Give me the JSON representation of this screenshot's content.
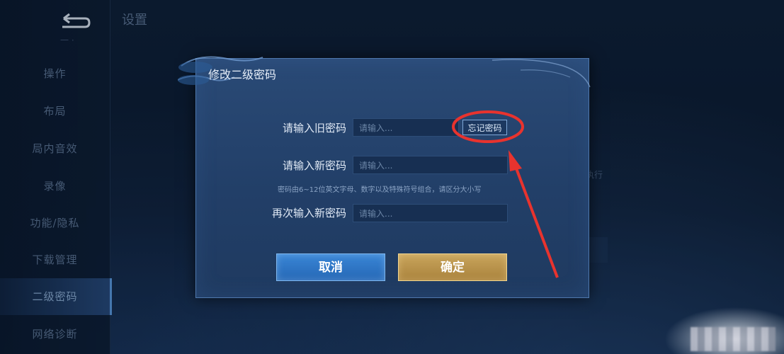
{
  "header": {
    "page_title": "设置"
  },
  "sidebar": {
    "partial_top": "一 ·",
    "items": [
      {
        "label": "操作"
      },
      {
        "label": "布局"
      },
      {
        "label": "局内音效"
      },
      {
        "label": "录像"
      },
      {
        "label": "功能/隐私"
      },
      {
        "label": "下载管理"
      },
      {
        "label": "二级密码"
      },
      {
        "label": "网络诊断"
      }
    ],
    "active_index": 6
  },
  "background": {
    "exec_text": "执行"
  },
  "dialog": {
    "title": "修改二级密码",
    "old_password_label": "请输入旧密码",
    "old_password_placeholder": "请输入...",
    "forgot_label": "忘记密码",
    "new_password_label": "请输入新密码",
    "new_password_placeholder": "请输入...",
    "hint": "密码由6~12位英文字母、数字以及特殊符号组合，请区分大小写",
    "confirm_password_label": "再次输入新密码",
    "confirm_password_placeholder": "请输入...",
    "cancel_label": "取消",
    "ok_label": "确定"
  },
  "colors": {
    "annotation_red": "#e8332e",
    "cancel_blue": "#2f78c8",
    "ok_gold": "#b8913f"
  }
}
